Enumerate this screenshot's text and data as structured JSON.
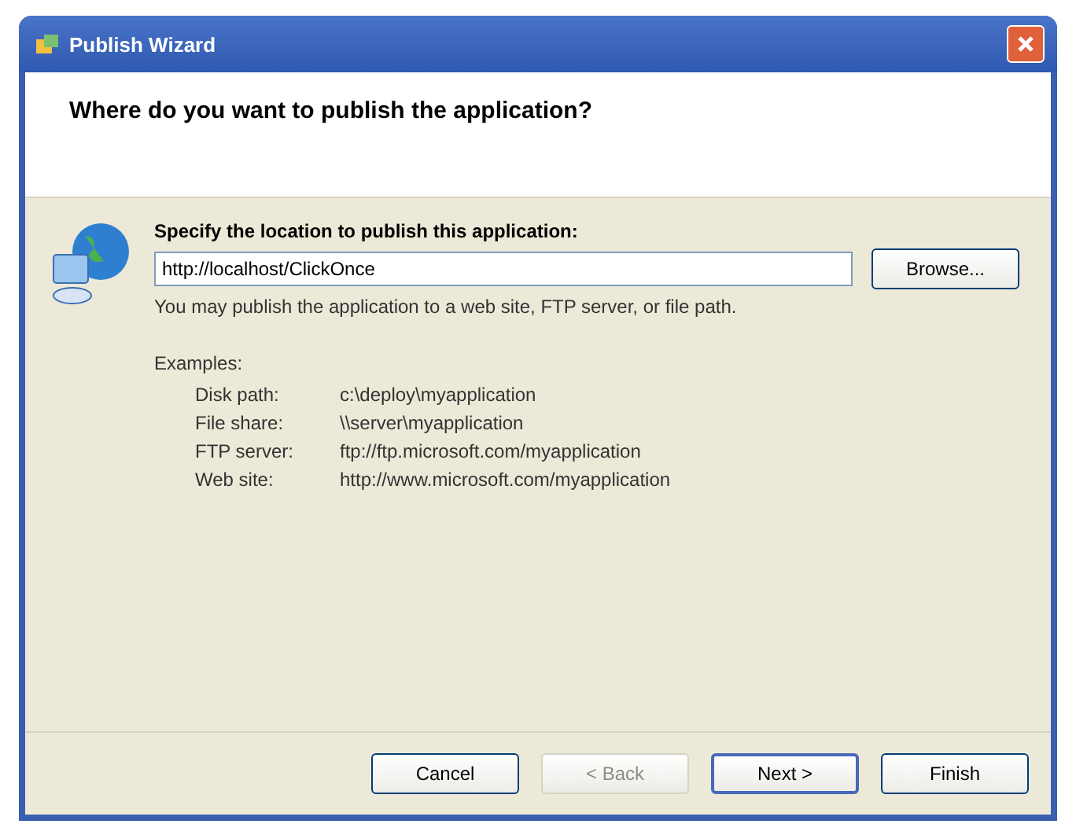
{
  "window": {
    "title": "Publish Wizard"
  },
  "header": {
    "title": "Where do you want to publish the application?"
  },
  "location": {
    "label": "Specify the location to publish this application:",
    "value": "http://localhost/ClickOnce",
    "browse_button": "Browse...",
    "hint": "You may publish the application to a web site, FTP server, or file path."
  },
  "examples": {
    "heading": "Examples:",
    "rows": [
      {
        "label": "Disk path:",
        "value": "c:\\deploy\\myapplication"
      },
      {
        "label": "File share:",
        "value": "\\\\server\\myapplication"
      },
      {
        "label": "FTP server:",
        "value": "ftp://ftp.microsoft.com/myapplication"
      },
      {
        "label": "Web site:",
        "value": "http://www.microsoft.com/myapplication"
      }
    ]
  },
  "buttons": [
    {
      "label": "Cancel",
      "disabled": false,
      "default": false
    },
    {
      "label": "< Back",
      "disabled": true,
      "default": false
    },
    {
      "label": "Next >",
      "disabled": false,
      "default": true
    },
    {
      "label": "Finish",
      "disabled": false,
      "default": false
    }
  ]
}
